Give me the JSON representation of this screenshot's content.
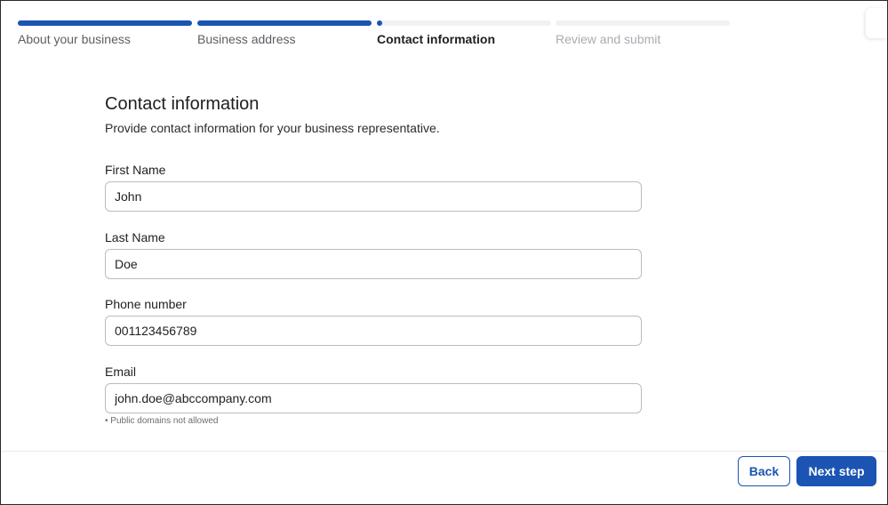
{
  "stepper": {
    "steps": [
      {
        "label": "About your business",
        "state": "done"
      },
      {
        "label": "Business address",
        "state": "done"
      },
      {
        "label": "Contact information",
        "state": "current"
      },
      {
        "label": "Review and submit",
        "state": "todo"
      }
    ]
  },
  "form": {
    "title": "Contact information",
    "subtitle": "Provide contact information for your business representative.",
    "fields": {
      "first_name": {
        "label": "First Name",
        "value": "John"
      },
      "last_name": {
        "label": "Last Name",
        "value": "Doe"
      },
      "phone": {
        "label": "Phone number",
        "value": "001123456789"
      },
      "email": {
        "label": "Email",
        "value": "john.doe@abccompany.com",
        "hint": "• Public domains not allowed"
      }
    }
  },
  "footer": {
    "back_label": "Back",
    "next_label": "Next step"
  },
  "colors": {
    "accent": "#1b54b2",
    "track": "#f0f1f3",
    "border": "#b9bcc1"
  }
}
